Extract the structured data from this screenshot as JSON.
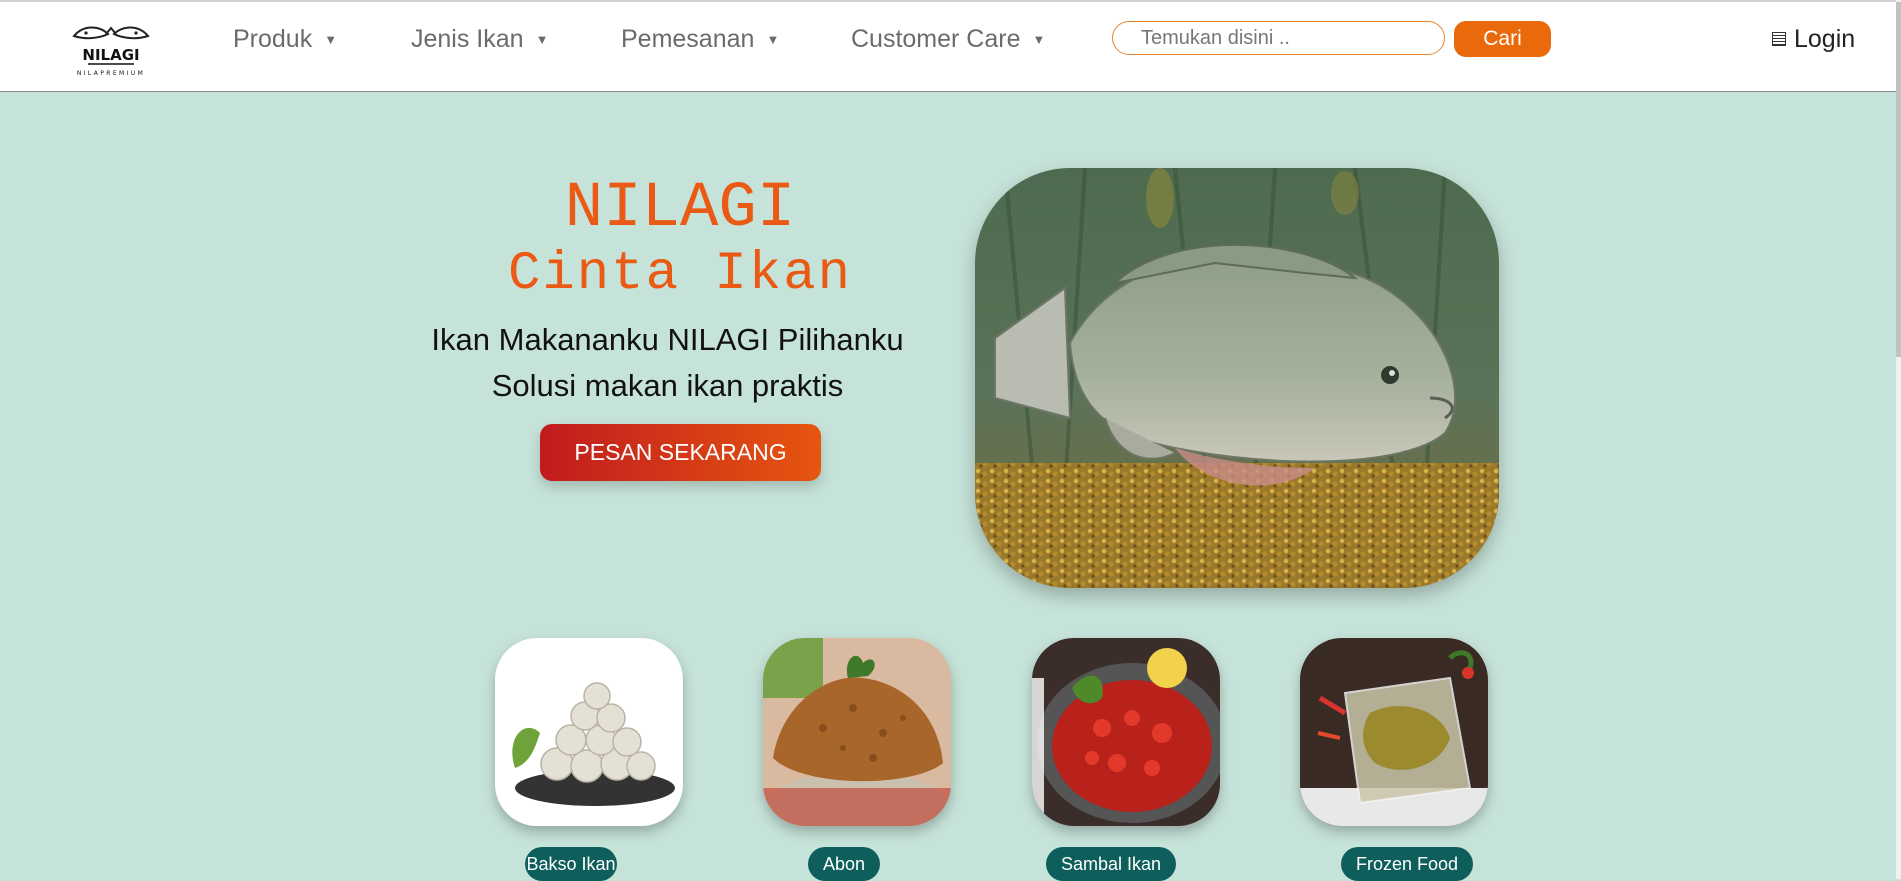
{
  "header": {
    "logo_text": "NILAGI",
    "logo_subtext": "NILAPREMIUM",
    "nav": [
      {
        "label": "Produk"
      },
      {
        "label": "Jenis Ikan"
      },
      {
        "label": "Pemesanan"
      },
      {
        "label": "Customer Care"
      }
    ],
    "caret": "▼",
    "search": {
      "placeholder": "Temukan disini ..",
      "value": ""
    },
    "search_button": "Cari",
    "login_label": "Login",
    "login_icon": "list-icon"
  },
  "hero": {
    "title": "NILAGI",
    "subtitle": "Cinta Ikan",
    "tagline_1": "Ikan Makananku NILAGI Pilihanku",
    "tagline_2": "Solusi makan ikan praktis",
    "cta_label": "PESAN SEKARANG"
  },
  "products": [
    {
      "label": "Bakso Ikan"
    },
    {
      "label": "Abon"
    },
    {
      "label": "Sambal Ikan"
    },
    {
      "label": "Frozen Food"
    }
  ],
  "colors": {
    "page_bg": "#c6e3d9",
    "accent_orange": "#ea6a0b",
    "title_orange": "#ea5a14",
    "pill_teal": "#0e5f5b",
    "cta_red": "#c01b1f"
  }
}
